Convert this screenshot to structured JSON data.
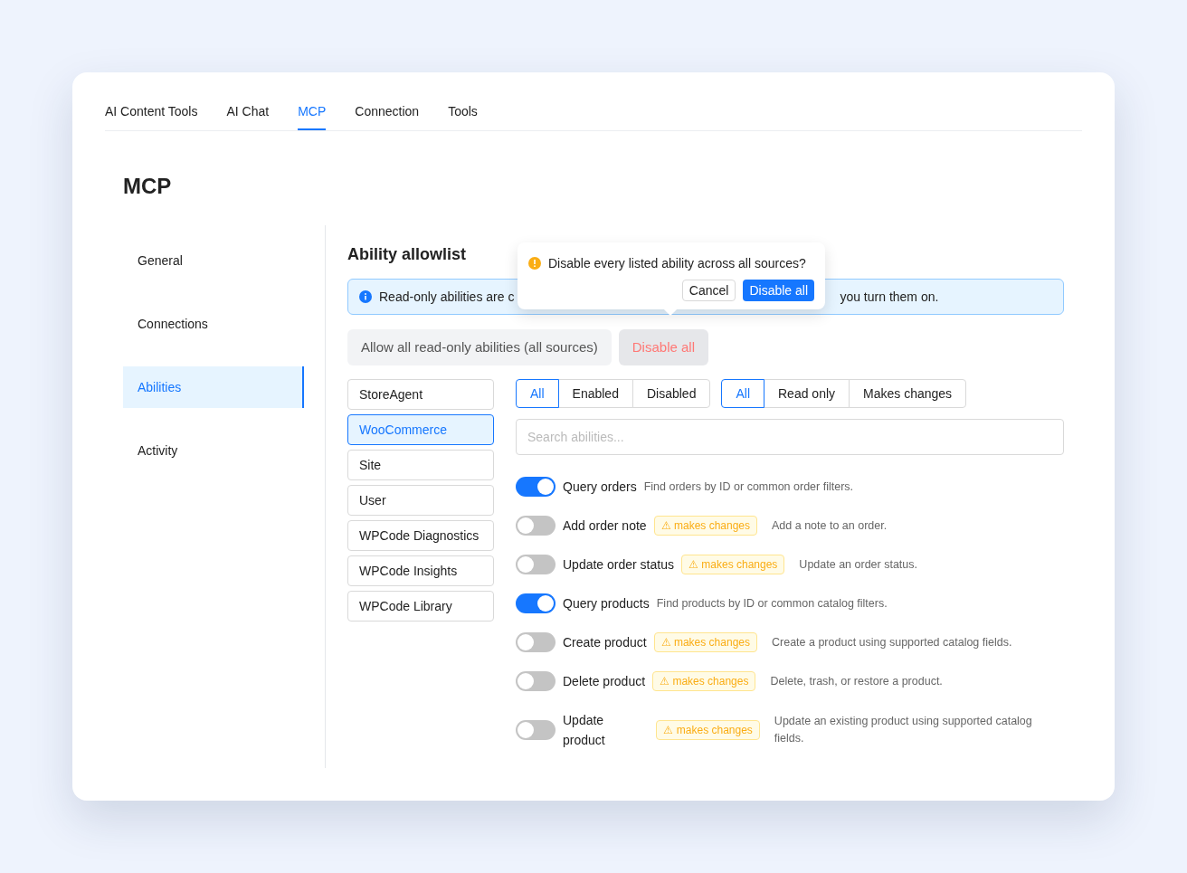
{
  "tabs": [
    {
      "label": "AI Content Tools",
      "selected": false
    },
    {
      "label": "AI Chat",
      "selected": false
    },
    {
      "label": "MCP",
      "selected": true
    },
    {
      "label": "Connection",
      "selected": false
    },
    {
      "label": "Tools",
      "selected": false
    }
  ],
  "page_title": "MCP",
  "nav": [
    {
      "label": "General",
      "selected": false
    },
    {
      "label": "Connections",
      "selected": false
    },
    {
      "label": "Abilities",
      "selected": true
    },
    {
      "label": "Activity",
      "selected": false
    }
  ],
  "section_title": "Ability allowlist",
  "notice": {
    "text_start": "Read-only abilities are c",
    "text_end": "you turn them on."
  },
  "actions": {
    "allow_all": "Allow all read-only abilities (all sources)",
    "disable_all": "Disable all"
  },
  "popconfirm": {
    "message": "Disable every listed ability across all sources?",
    "cancel": "Cancel",
    "confirm": "Disable all"
  },
  "sources": [
    {
      "label": "StoreAgent",
      "selected": false
    },
    {
      "label": "WooCommerce",
      "selected": true
    },
    {
      "label": "Site",
      "selected": false
    },
    {
      "label": "User",
      "selected": false
    },
    {
      "label": "WPCode Diagnostics",
      "selected": false
    },
    {
      "label": "WPCode Insights",
      "selected": false
    },
    {
      "label": "WPCode Library",
      "selected": false
    }
  ],
  "status_filter": [
    {
      "label": "All",
      "selected": true
    },
    {
      "label": "Enabled",
      "selected": false
    },
    {
      "label": "Disabled",
      "selected": false
    }
  ],
  "type_filter": [
    {
      "label": "All",
      "selected": true
    },
    {
      "label": "Read only",
      "selected": false
    },
    {
      "label": "Makes changes",
      "selected": false
    }
  ],
  "search": {
    "placeholder": "Search abilities..."
  },
  "abilities": [
    {
      "name": "Query orders",
      "on": true,
      "description": "Find orders by ID or common order filters."
    },
    {
      "name": "Add order note",
      "on": false,
      "badge": "⚠ makes changes",
      "description": "Add a note to an order."
    },
    {
      "name": "Update order status",
      "on": false,
      "badge": "⚠ makes changes",
      "description": "Update an order status."
    },
    {
      "name": "Query products",
      "on": true,
      "description": "Find products by ID or common catalog filters."
    },
    {
      "name": "Create product",
      "on": false,
      "badge": "⚠ makes changes",
      "description": "Create a product using supported catalog fields."
    },
    {
      "name": "Delete product",
      "on": false,
      "badge": "⚠ makes changes",
      "description": "Delete, trash, or restore a product."
    },
    {
      "name": "Update product",
      "on": false,
      "badge": "⚠ makes changes",
      "description": "Update an existing product using supported catalog fields."
    }
  ]
}
